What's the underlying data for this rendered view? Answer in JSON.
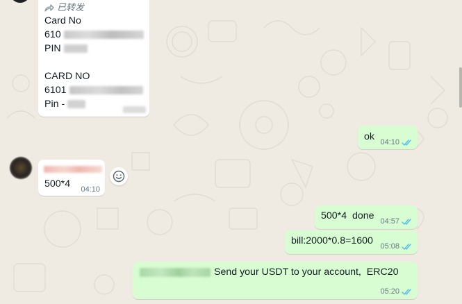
{
  "messages": {
    "forwarded": {
      "forward_label": "已转发",
      "line1": "Card No",
      "card1_prefix": "610",
      "pin1_label": "PIN",
      "line2": "CARD NO",
      "card2_prefix": "6101",
      "pin2_label": "Pin -"
    },
    "ok": {
      "text": "ok",
      "time": "04:10"
    },
    "incoming": {
      "text": "500*4",
      "time": "04:10"
    },
    "done": {
      "text": "500*4  done",
      "time": "04:57"
    },
    "bill": {
      "text": "bill:2000*0.8=1600",
      "time": "05:08"
    },
    "usdt": {
      "text": "Send your USDT to your account,  ERC20",
      "time": "05:20"
    }
  },
  "colors": {
    "background": "#efeae2",
    "incoming_bubble": "#ffffff",
    "outgoing_bubble": "#d9fdd3",
    "read_tick": "#53bdeb"
  },
  "icons": {
    "forward": "forward-arrow-icon",
    "emoji": "emoji-reaction-icon",
    "read_receipt": "double-check-icon"
  }
}
